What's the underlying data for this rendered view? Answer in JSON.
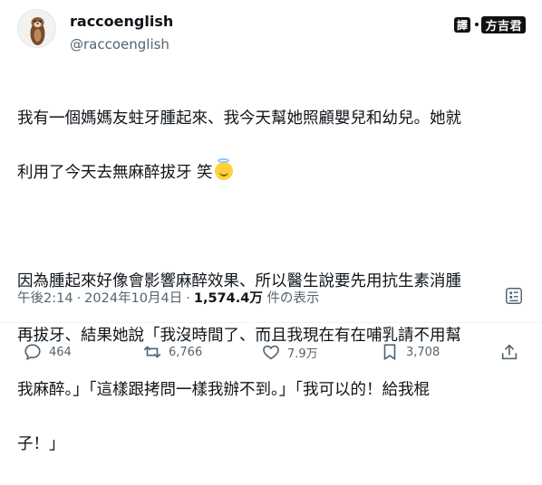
{
  "author": {
    "display_name": "raccoenglish",
    "handle": "@raccoenglish"
  },
  "watermark": {
    "prefix": "譯",
    "name": "方吉君"
  },
  "tweet": {
    "line1": "我有一個媽媽友蛀牙腫起來、我今天幫她照顧嬰兒和幼兒。她就",
    "line2": "利用了今天去無麻醉拔牙 笑",
    "line3": "因為腫起來好像會影響麻醉效果、所以醫生說要先用抗生素消腫",
    "line4": "再拔牙、結果她說「我沒時間了、而且我現在有在哺乳請不用幫",
    "line5": "我麻醉。」「這樣跟拷問一樣我辦不到。」「我可以的！給我棍",
    "line6": "子！」",
    "emoji_icon": "smiling-face-with-halo"
  },
  "meta": {
    "time": "午後2:14",
    "date": "2024年10月4日",
    "views": "1,574.4万",
    "views_label": "件の表示",
    "separator": "·"
  },
  "actions": {
    "replies": "464",
    "reposts": "6,766",
    "likes": "7.9万",
    "bookmarks": "3,708"
  },
  "colors": {
    "text": "#0f1419",
    "secondary": "#536471"
  }
}
